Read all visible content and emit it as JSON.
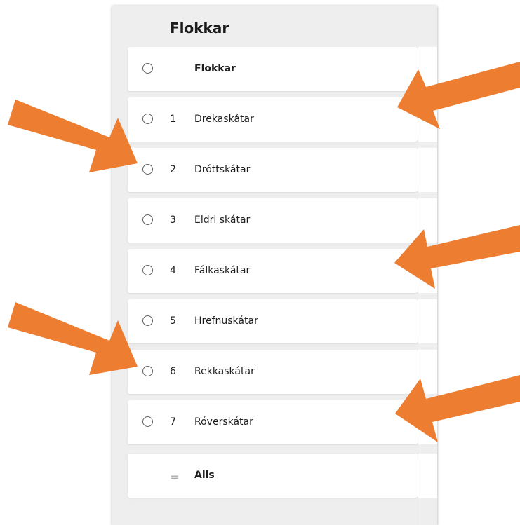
{
  "panel": {
    "title": "Flokkar"
  },
  "header_row": {
    "label": "Flokkar"
  },
  "rows": [
    {
      "num": "1",
      "label": "Drekaskátar"
    },
    {
      "num": "2",
      "label": "Dróttskátar"
    },
    {
      "num": "3",
      "label": "Eldri skátar"
    },
    {
      "num": "4",
      "label": "Fálkaskátar"
    },
    {
      "num": "5",
      "label": "Hrefnuskátar"
    },
    {
      "num": "6",
      "label": "Rekkaskátar"
    },
    {
      "num": "7",
      "label": "Róverskátar"
    }
  ],
  "total_row": {
    "symbol": "=",
    "label": "Alls"
  },
  "colors": {
    "arrow": "#ED7D31",
    "panel_bg": "#EEEEEE",
    "row_bg": "#FFFFFF"
  }
}
